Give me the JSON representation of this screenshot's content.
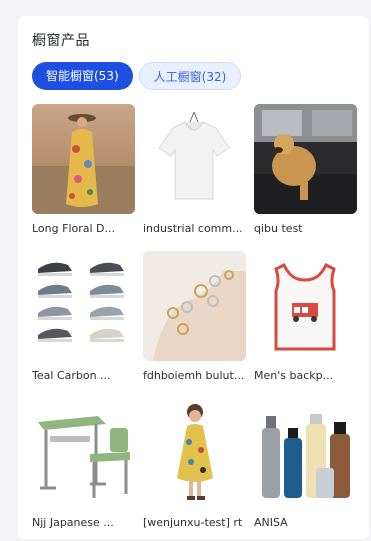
{
  "section": {
    "title": "橱窗产品"
  },
  "tabs": [
    {
      "label": "智能橱窗(53)",
      "active": true
    },
    {
      "label": "人工橱窗(32)",
      "active": false
    }
  ],
  "products": [
    {
      "name": "Long Floral D...",
      "image": "woman-floral-dress"
    },
    {
      "name": "industrial comm...",
      "image": "white-tshirt"
    },
    {
      "name": "qibu test",
      "image": "dog-in-car"
    },
    {
      "name": "Teal Carbon ...",
      "image": "sneakers-grid"
    },
    {
      "name": "fdhboiemh bulut...",
      "image": "rings-on-hand"
    },
    {
      "name": "Men's backp...",
      "image": "tank-top"
    },
    {
      "name": "Njj Japanese ...",
      "image": "school-desk-chair"
    },
    {
      "name": "[wenjunxu-test] rt",
      "image": "girl-floral-dress"
    },
    {
      "name": "ANISA",
      "image": "cosmetic-bottles"
    }
  ],
  "colors": {
    "accent": "#1d4fe0",
    "tab_inactive_bg": "#e8efff",
    "tab_inactive_text": "#3a63d8"
  }
}
